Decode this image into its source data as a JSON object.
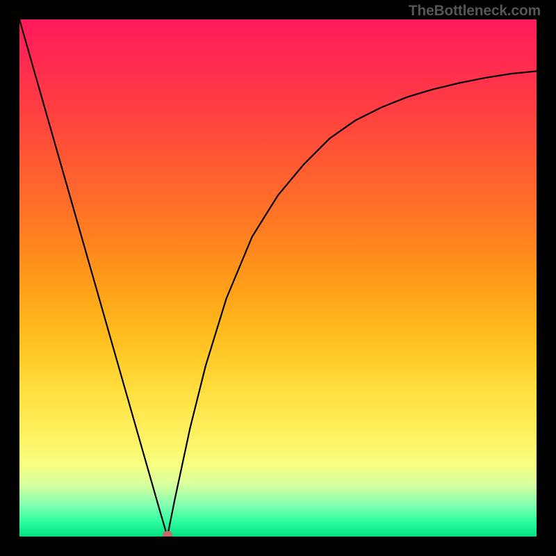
{
  "credit": "TheBottleneck.com",
  "chart_data": {
    "type": "line",
    "title": "",
    "xlabel": "",
    "ylabel": "",
    "xlim": [
      0,
      100
    ],
    "ylim": [
      0,
      100
    ],
    "grid": false,
    "series": [
      {
        "name": "bottleneck-curve",
        "x": [
          0,
          3,
          6,
          9,
          12,
          15,
          18,
          21,
          24,
          27,
          28.6,
          30,
          33,
          36,
          40,
          45,
          50,
          55,
          60,
          65,
          70,
          75,
          80,
          85,
          90,
          95,
          100
        ],
        "y": [
          100,
          89.5,
          79,
          68.5,
          58,
          47.5,
          37,
          26.5,
          16,
          5.5,
          0,
          7,
          21,
          33,
          46,
          58,
          66,
          72,
          77,
          80.5,
          83,
          85,
          86.5,
          87.7,
          88.7,
          89.5,
          90
        ]
      }
    ],
    "legend": null,
    "marker": {
      "name": "minimum-dot",
      "x": 28.6,
      "y": 0,
      "color": "#c86a6a"
    },
    "gradient_stops": [
      {
        "pos": 0.0,
        "color": "#ff1a5e"
      },
      {
        "pos": 0.18,
        "color": "#ff4040"
      },
      {
        "pos": 0.42,
        "color": "#ff8020"
      },
      {
        "pos": 0.62,
        "color": "#ffc020"
      },
      {
        "pos": 0.8,
        "color": "#fff060"
      },
      {
        "pos": 0.94,
        "color": "#80ffb0"
      },
      {
        "pos": 1.0,
        "color": "#00e080"
      }
    ]
  }
}
